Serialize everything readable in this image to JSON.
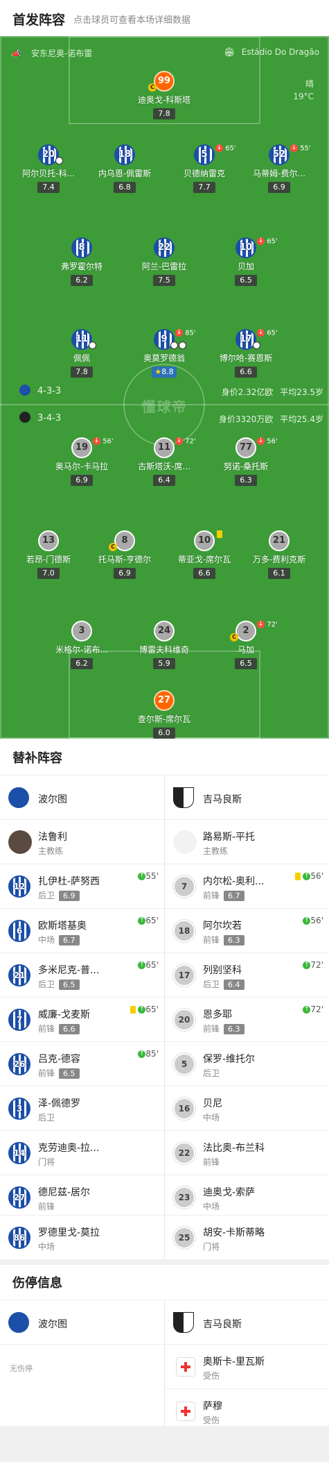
{
  "header": {
    "title": "首发阵容",
    "subtitle": "点击球员可查看本场详细数据"
  },
  "pitch": {
    "referee": "安东尼奥-诺布雷",
    "stadium": "Estádio Do Dragão",
    "weather": "晴",
    "temperature": "19°C",
    "watermark": "懂球帝",
    "home": {
      "formation": "4-3-3",
      "value": "身价2.32亿欧",
      "avg_age": "平均23.5岁"
    },
    "away": {
      "formation": "3-4-3",
      "value": "身价3320万欧",
      "avg_age": "平均25.4岁"
    }
  },
  "home_players": [
    {
      "num": "99",
      "name": "迪奥戈-科斯塔",
      "rating": "7.8",
      "gk": true
    },
    {
      "num": "20",
      "name": "阿尔贝托-科...",
      "rating": "7.4"
    },
    {
      "num": "18",
      "name": "内乌恩-佩雷斯",
      "rating": "6.8"
    },
    {
      "num": "5",
      "name": "贝德纳雷克",
      "rating": "7.7",
      "sub_min": "65'"
    },
    {
      "num": "52",
      "name": "马蒂姆-费尔...",
      "rating": "6.9",
      "sub_min": "55'"
    },
    {
      "num": "8",
      "name": "弗罗霍尔特",
      "rating": "6.2"
    },
    {
      "num": "22",
      "name": "阿兰-巴雷拉",
      "rating": "7.5"
    },
    {
      "num": "10",
      "name": "贝加",
      "rating": "6.5",
      "sub_min": "65'"
    },
    {
      "num": "11",
      "name": "佩佩",
      "rating": "7.8"
    },
    {
      "num": "9",
      "name": "奥莫罗德翁",
      "rating": "8.8",
      "sub_min": "85'"
    },
    {
      "num": "17",
      "name": "博尔哈-赛恩斯",
      "rating": "6.6",
      "sub_min": "65'"
    }
  ],
  "away_players": [
    {
      "num": "19",
      "name": "奥马尔-卡马拉",
      "rating": "6.9",
      "sub_min": "56'"
    },
    {
      "num": "11",
      "name": "古斯塔沃-席...",
      "rating": "6.4",
      "sub_min": "72'"
    },
    {
      "num": "77",
      "name": "努诺-桑托斯",
      "rating": "6.3",
      "sub_min": "56'"
    },
    {
      "num": "13",
      "name": "若昂-门德斯",
      "rating": "7.0"
    },
    {
      "num": "8",
      "name": "托马斯-亨德尔",
      "rating": "6.9"
    },
    {
      "num": "10",
      "name": "蒂亚戈-席尔瓦",
      "rating": "6.6"
    },
    {
      "num": "21",
      "name": "万多-费利克斯",
      "rating": "6.1"
    },
    {
      "num": "3",
      "name": "米格尔-诺布...",
      "rating": "6.2"
    },
    {
      "num": "24",
      "name": "博雷夫科维奇",
      "rating": "5.9"
    },
    {
      "num": "2",
      "name": "马加",
      "rating": "6.5",
      "sub_min": "72'"
    },
    {
      "num": "27",
      "name": "查尔斯-席尔瓦",
      "rating": "6.0",
      "gk": true
    }
  ],
  "subs": {
    "title": "替补阵容",
    "home_team": "波尔图",
    "away_team": "吉马良斯",
    "home_coach": "法鲁利",
    "away_coach": "路易斯-平托",
    "coach_role": "主教练",
    "home": [
      {
        "num": "12",
        "name": "扎伊杜-萨努西",
        "pos": "后卫",
        "rating": "6.9",
        "sub_min": "55'"
      },
      {
        "num": "6",
        "name": "欧斯塔基奥",
        "pos": "中场",
        "rating": "6.7",
        "sub_min": "65'"
      },
      {
        "num": "21",
        "name": "多米尼克-普...",
        "pos": "后卫",
        "rating": "6.5",
        "sub_min": "65'"
      },
      {
        "num": "7",
        "name": "威廉-戈麦斯",
        "pos": "前锋",
        "rating": "6.6",
        "sub_min": "65'"
      },
      {
        "num": "26",
        "name": "吕克-德容",
        "pos": "前锋",
        "rating": "6.5",
        "sub_min": "85'"
      },
      {
        "num": "3",
        "name": "泽-佩德罗",
        "pos": "后卫"
      },
      {
        "num": "14",
        "name": "克劳迪奥-拉...",
        "pos": "门将"
      },
      {
        "num": "27",
        "name": "德尼兹-居尔",
        "pos": "前锋"
      },
      {
        "num": "86",
        "name": "罗德里戈-莫拉",
        "pos": "中场"
      }
    ],
    "away": [
      {
        "num": "7",
        "name": "内尔松-奥利...",
        "pos": "前锋",
        "rating": "6.7",
        "sub_min": "56'"
      },
      {
        "num": "18",
        "name": "阿尔坎若",
        "pos": "前锋",
        "rating": "6.3",
        "sub_min": "56'"
      },
      {
        "num": "17",
        "name": "列别坚科",
        "pos": "后卫",
        "rating": "6.4",
        "sub_min": "72'"
      },
      {
        "num": "20",
        "name": "恩多耶",
        "pos": "前锋",
        "rating": "6.3",
        "sub_min": "72'"
      },
      {
        "num": "5",
        "name": "保罗-维托尔",
        "pos": "后卫"
      },
      {
        "num": "16",
        "name": "贝尼",
        "pos": "中场"
      },
      {
        "num": "22",
        "name": "法比奥-布兰科",
        "pos": "前锋"
      },
      {
        "num": "23",
        "name": "迪奥戈-索萨",
        "pos": "中场"
      },
      {
        "num": "25",
        "name": "胡安-卡斯蒂略",
        "pos": "门将"
      }
    ]
  },
  "injury": {
    "title": "伤停信息",
    "home_team": "波尔图",
    "away_team": "吉马良斯",
    "home_none": "无伤停",
    "away": [
      {
        "name": "奥斯卡-里瓦斯",
        "status": "受伤"
      },
      {
        "name": "萨穆",
        "status": "受伤"
      }
    ]
  },
  "colors": {
    "pitch": "#3d9b38",
    "home": "#1c4fa8",
    "gk": "#ff6600",
    "sub_out": "#ff4d3b",
    "sub_in": "#3ab83a"
  }
}
